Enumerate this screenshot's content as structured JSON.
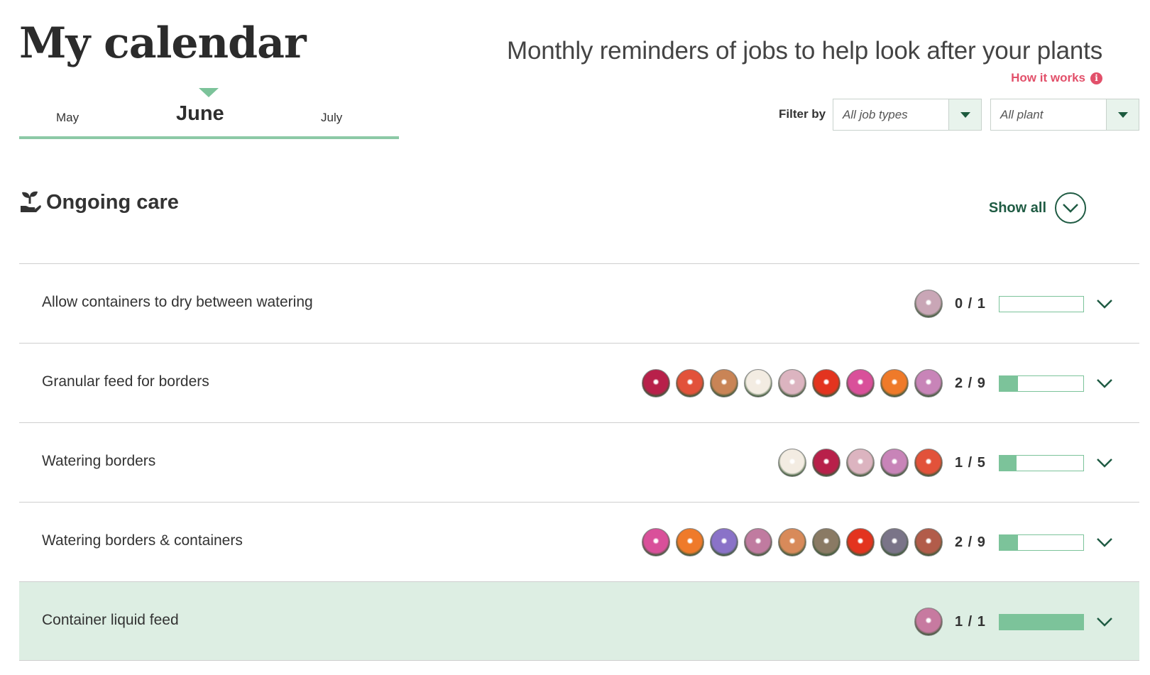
{
  "header": {
    "title": "My calendar",
    "subtitle": "Monthly reminders of jobs to help look after your plants",
    "how_it_works": "How it works",
    "info_icon_glyph": "i"
  },
  "months": {
    "prev": "May",
    "current": "June",
    "next": "July"
  },
  "filter": {
    "label": "Filter by",
    "job_types": "All job types",
    "plant": "All plant"
  },
  "section": {
    "title": "Ongoing care",
    "icon": "hand-seedling-icon",
    "show_all": "Show all"
  },
  "colors": {
    "accent_green": "#7cc39a",
    "dark_green": "#1f5b43",
    "link_pink": "#e2506a",
    "done_row_bg": "#ddeee3"
  },
  "jobs": [
    {
      "label": "Allow containers to dry between watering",
      "count": "0 / 1",
      "progress": 0,
      "done": false,
      "thumbs": [
        "#c9a6b6"
      ]
    },
    {
      "label": "Granular feed for borders",
      "count": "2 / 9",
      "progress": 0.2222,
      "done": false,
      "thumbs": [
        "#b8204a",
        "#e2523a",
        "#c98456",
        "#f3ece2",
        "#dcb4c0",
        "#e3341f",
        "#d9509a",
        "#ef7a2a",
        "#c884b8"
      ]
    },
    {
      "label": "Watering borders",
      "count": "1 / 5",
      "progress": 0.2,
      "done": false,
      "thumbs": [
        "#f3ece2",
        "#b8204a",
        "#dcb4c0",
        "#c884b8",
        "#e2523a"
      ]
    },
    {
      "label": "Watering borders & containers",
      "count": "2 / 9",
      "progress": 0.2222,
      "done": false,
      "thumbs": [
        "#d9509a",
        "#ef7a2a",
        "#8a72c8",
        "#c07ba0",
        "#d88a5a",
        "#8a7a64",
        "#e3341f",
        "#7a7488",
        "#b25c4a"
      ]
    },
    {
      "label": "Container liquid feed",
      "count": "1 / 1",
      "progress": 1,
      "done": true,
      "thumbs": [
        "#c77aa0"
      ]
    }
  ]
}
